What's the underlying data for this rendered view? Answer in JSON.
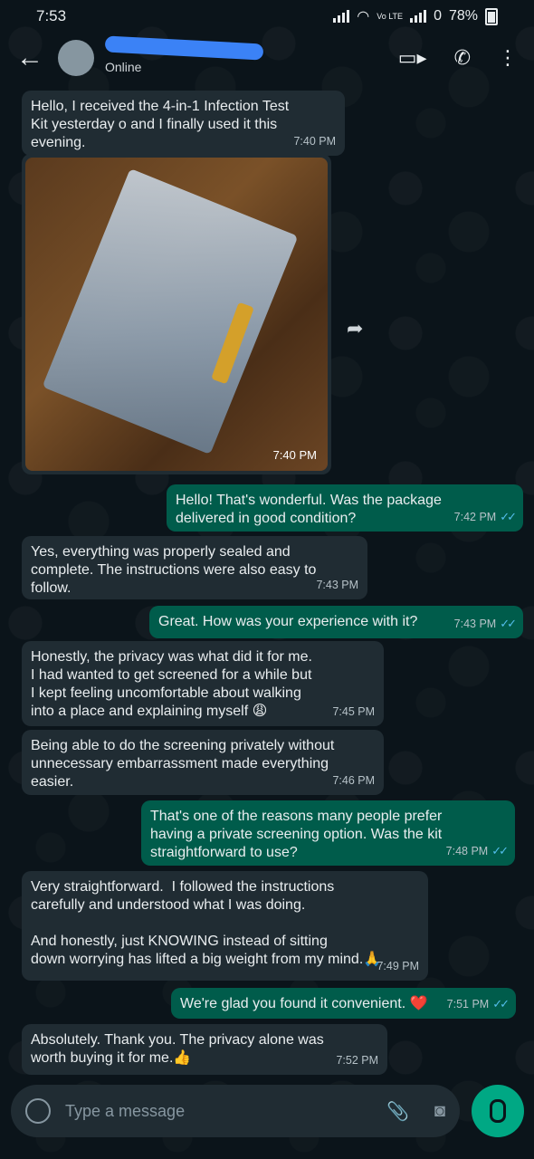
{
  "statusbar": {
    "time": "7:53",
    "battery": "78%",
    "volte": "Vo LTE"
  },
  "header": {
    "status": "Online"
  },
  "messages": [
    {
      "dir": "in",
      "text": "Hello, I received the 4-in-1 Infection Test\nKit yesterday o and I finally used it this\nevening.",
      "time": "7:40 PM"
    },
    {
      "dir": "in",
      "type": "image",
      "time": "7:40 PM"
    },
    {
      "dir": "out",
      "text": "Hello! That's wonderful. Was the package\ndelivered in good condition?",
      "time": "7:42 PM"
    },
    {
      "dir": "in",
      "text": "Yes, everything was properly sealed and\ncomplete. The instructions were also easy to\nfollow.",
      "time": "7:43 PM"
    },
    {
      "dir": "out",
      "text": "Great. How was your experience with it?",
      "time": "7:43 PM"
    },
    {
      "dir": "in",
      "text": "Honestly, the privacy was what did it for me.\nI had wanted to get screened for a while but\nI kept feeling uncomfortable about walking\ninto a place and explaining myself 😩",
      "time": "7:45 PM"
    },
    {
      "dir": "in",
      "text": "Being able to do the screening privately without\nunnecessary embarrassment made everything\neasier.",
      "time": "7:46 PM"
    },
    {
      "dir": "out",
      "text": "That's one of the reasons many people prefer\nhaving a private screening option. Was the kit\nstraightforward to use?",
      "time": "7:48 PM"
    },
    {
      "dir": "in",
      "text": "Very straightforward.  I followed the instructions\ncarefully and understood what I was doing.\n\nAnd honestly, just KNOWING instead of sitting\ndown worrying has lifted a big weight from my mind.🙏",
      "time": "7:49 PM"
    },
    {
      "dir": "out",
      "text": "We're glad you found it convenient. ❤️",
      "time": "7:51 PM"
    },
    {
      "dir": "in",
      "text": "Absolutely. Thank you. The privacy alone was\nworth buying it for me.👍",
      "time": "7:52 PM"
    }
  ],
  "composer": {
    "placeholder": "Type a message"
  },
  "colors": {
    "incoming": "#202c33",
    "outgoing": "#005c4b",
    "accent": "#00a884",
    "read_tick": "#53bdeb"
  },
  "icons": [
    "back-arrow-icon",
    "video-call-icon",
    "phone-icon",
    "more-options-icon",
    "forward-icon",
    "emoji-icon",
    "attach-icon",
    "camera-icon",
    "mic-icon"
  ]
}
